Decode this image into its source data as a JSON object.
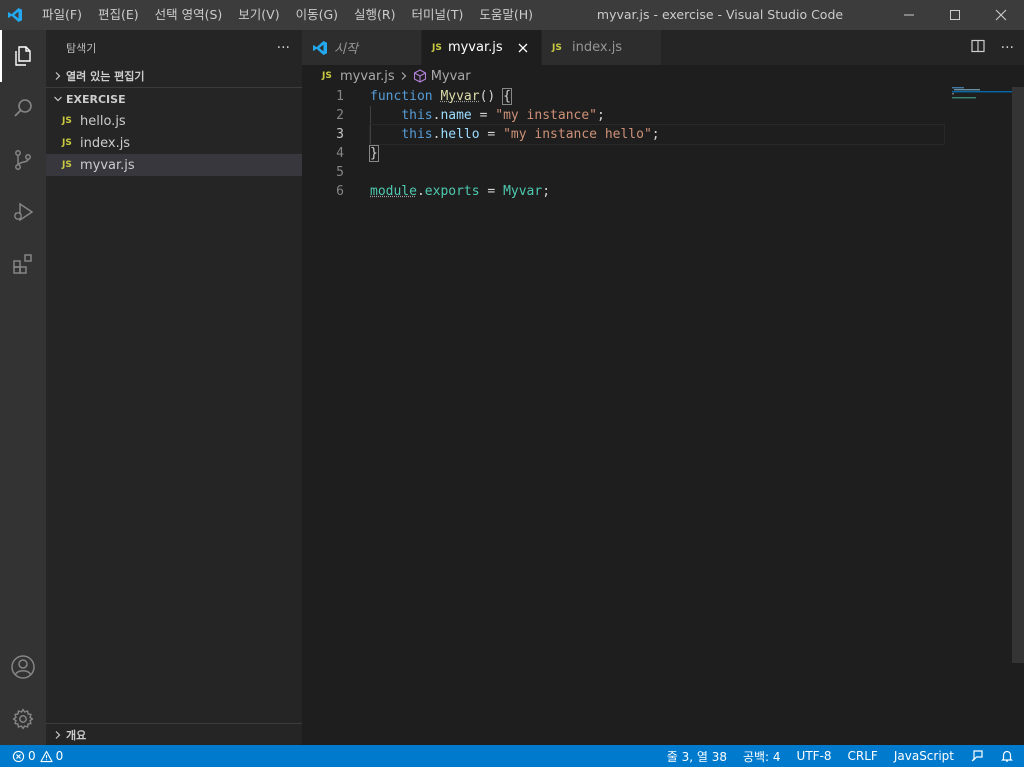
{
  "titlebar": {
    "menu": [
      "파일(F)",
      "편집(E)",
      "선택 영역(S)",
      "보기(V)",
      "이동(G)",
      "실행(R)",
      "터미널(T)",
      "도움말(H)"
    ],
    "window_title": "myvar.js - exercise - Visual Studio Code"
  },
  "sidebar": {
    "title": "탐색기",
    "more_label": "···",
    "open_editors_label": "열려 있는 편집기",
    "folder_label": "EXERCISE",
    "js_badge": "JS",
    "files": [
      "hello.js",
      "index.js",
      "myvar.js"
    ],
    "selected_file": "myvar.js",
    "outline_label": "개요"
  },
  "tabs": [
    {
      "label": "시작",
      "icon": "vscode-logo-icon",
      "active": false
    },
    {
      "label": "myvar.js",
      "icon": "js-icon",
      "active": true
    },
    {
      "label": "index.js",
      "icon": "js-icon",
      "active": false
    }
  ],
  "tab_actions": {
    "more_label": "···"
  },
  "breadcrumb": {
    "file": "myvar.js",
    "symbol": "Myvar"
  },
  "editor": {
    "line_numbers": [
      "1",
      "2",
      "3",
      "4",
      "5",
      "6"
    ],
    "current_line": 3
  },
  "statusbar": {
    "errors": "0",
    "warnings": "0",
    "position": "줄 3, 열 38",
    "spaces": "공백: 4",
    "encoding": "UTF-8",
    "eol": "CRLF",
    "language": "JavaScript"
  },
  "colors": {
    "statusbar": "#007acc",
    "activitybar": "#333333",
    "sidebar": "#252526",
    "editor": "#1e1e1e",
    "titlebar": "#3c3c3c"
  }
}
